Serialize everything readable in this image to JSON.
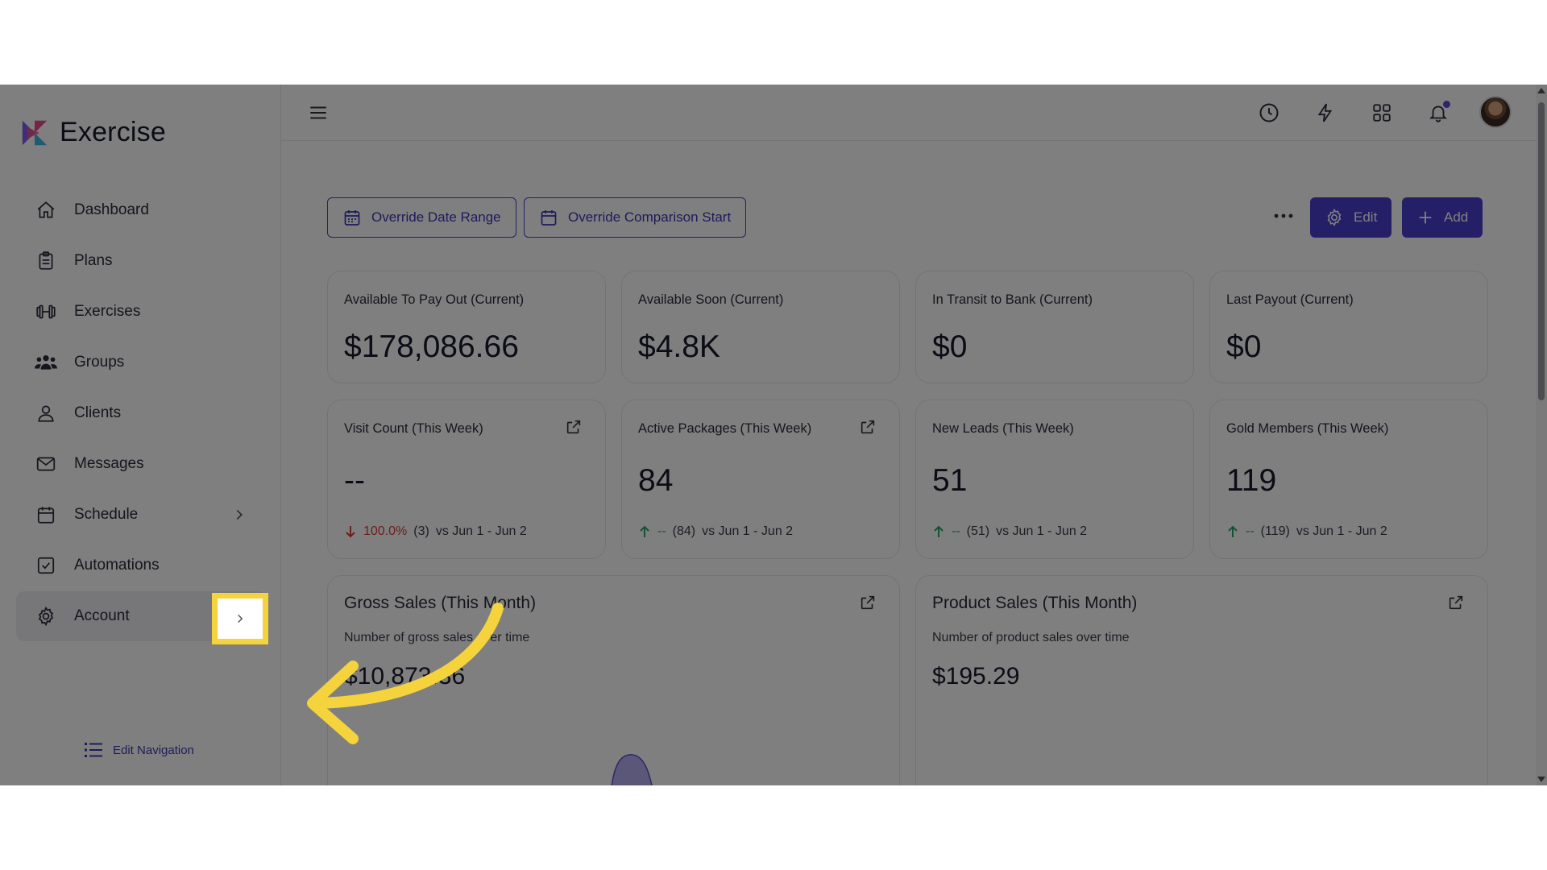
{
  "app": {
    "name": "Exercise"
  },
  "sidebar": {
    "items": [
      {
        "label": "Dashboard",
        "icon": "home-icon"
      },
      {
        "label": "Plans",
        "icon": "clipboard-icon"
      },
      {
        "label": "Exercises",
        "icon": "dumbbell-icon"
      },
      {
        "label": "Groups",
        "icon": "users-icon"
      },
      {
        "label": "Clients",
        "icon": "user-icon"
      },
      {
        "label": "Messages",
        "icon": "mail-icon"
      },
      {
        "label": "Schedule",
        "icon": "calendar-icon"
      },
      {
        "label": "Automations",
        "icon": "check-square-icon"
      },
      {
        "label": "Account",
        "icon": "gear-icon"
      }
    ],
    "edit_navigation": "Edit Navigation"
  },
  "toolbar": {
    "override_date_range": "Override Date Range",
    "override_comparison_start": "Override Comparison Start",
    "edit": "Edit",
    "add": "Add"
  },
  "stats_top": [
    {
      "title": "Available To Pay Out (Current)",
      "value": "$178,086.66"
    },
    {
      "title": "Available Soon (Current)",
      "value": "$4.8K"
    },
    {
      "title": "In Transit to Bank (Current)",
      "value": "$0"
    },
    {
      "title": "Last Payout (Current)",
      "value": "$0"
    }
  ],
  "stats_week": [
    {
      "title": "Visit Count (This Week)",
      "value": "--",
      "change": "100.0%",
      "prev": "(3)",
      "compare": "vs Jun 1 - Jun 2",
      "direction": "down"
    },
    {
      "title": "Active Packages (This Week)",
      "value": "84",
      "change": "--",
      "prev": "(84)",
      "compare": "vs Jun 1 - Jun 2",
      "direction": "up"
    },
    {
      "title": "New Leads (This Week)",
      "value": "51",
      "change": "--",
      "prev": "(51)",
      "compare": "vs Jun 1 - Jun 2",
      "direction": "up"
    },
    {
      "title": "Gold Members (This Week)",
      "value": "119",
      "change": "--",
      "prev": "(119)",
      "compare": "vs Jun 1 - Jun 2",
      "direction": "up"
    }
  ],
  "charts": [
    {
      "title": "Gross Sales (This Month)",
      "subtitle": "Number of gross sales over time",
      "value": "$10,873.36"
    },
    {
      "title": "Product Sales (This Month)",
      "subtitle": "Number of product sales over time",
      "value": "$195.29"
    }
  ],
  "colors": {
    "accent": "#4a3fd0",
    "highlight": "#f5d33c",
    "down": "#d6403a",
    "up": "#2aa36b"
  }
}
